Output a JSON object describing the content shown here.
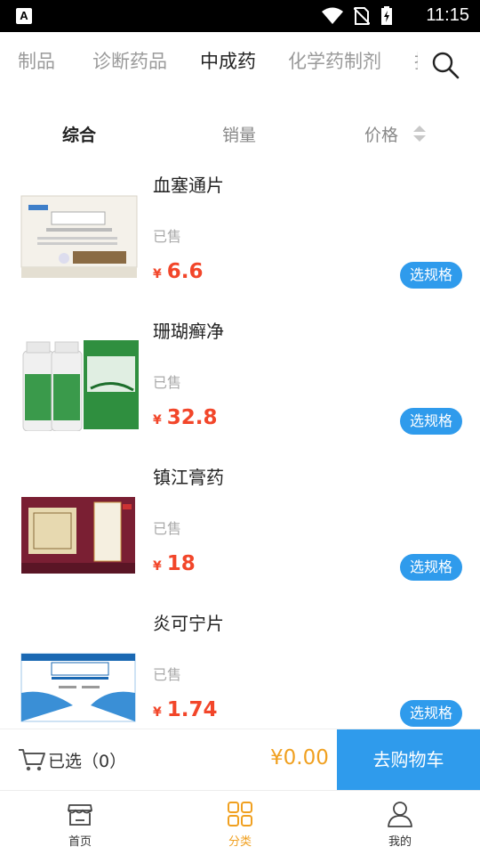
{
  "status_bar": {
    "time": "11:15",
    "notification_letter": "A",
    "icons": [
      "wifi-icon",
      "no-sim-icon",
      "battery-charging-icon"
    ]
  },
  "category_tabs": {
    "items": [
      {
        "label": "制品",
        "active": false
      },
      {
        "label": "诊断药品",
        "active": false
      },
      {
        "label": "中成药",
        "active": true
      },
      {
        "label": "化学药制剂",
        "active": false
      },
      {
        "label": "抗",
        "active": false
      }
    ],
    "search_icon": "search-icon"
  },
  "sort_bar": {
    "items": [
      {
        "label": "综合",
        "active": true
      },
      {
        "label": "销量",
        "active": false
      },
      {
        "label": "价格",
        "active": false
      }
    ]
  },
  "products": [
    {
      "name": "血塞通片",
      "sold_label": "已售",
      "currency": "¥",
      "price": "6.6",
      "button": "选规格",
      "image_icon": "product-box-image"
    },
    {
      "name": "珊瑚癣净",
      "sold_label": "已售",
      "currency": "¥",
      "price": "32.8",
      "button": "选规格",
      "image_icon": "product-bottle-image"
    },
    {
      "name": "镇江膏药",
      "sold_label": "已售",
      "currency": "¥",
      "price": "18",
      "button": "选规格",
      "image_icon": "product-box-image"
    },
    {
      "name": "炎可宁片",
      "sold_label": "已售",
      "currency": "¥",
      "price": "1.74",
      "button": "选规格",
      "image_icon": "product-box-image"
    }
  ],
  "cart": {
    "selected_label": "已选（0）",
    "total": "¥0.00",
    "checkout_label": "去购物车"
  },
  "bottom_nav": {
    "items": [
      {
        "label": "首页",
        "icon": "store-icon",
        "active": false
      },
      {
        "label": "分类",
        "icon": "category-grid-icon",
        "active": true
      },
      {
        "label": "我的",
        "icon": "user-icon",
        "active": false
      }
    ]
  },
  "colors": {
    "accent": "#2f9bec",
    "price": "#f2462a",
    "active_nav": "#f0a020",
    "tab_inactive": "#9a9a9a"
  }
}
